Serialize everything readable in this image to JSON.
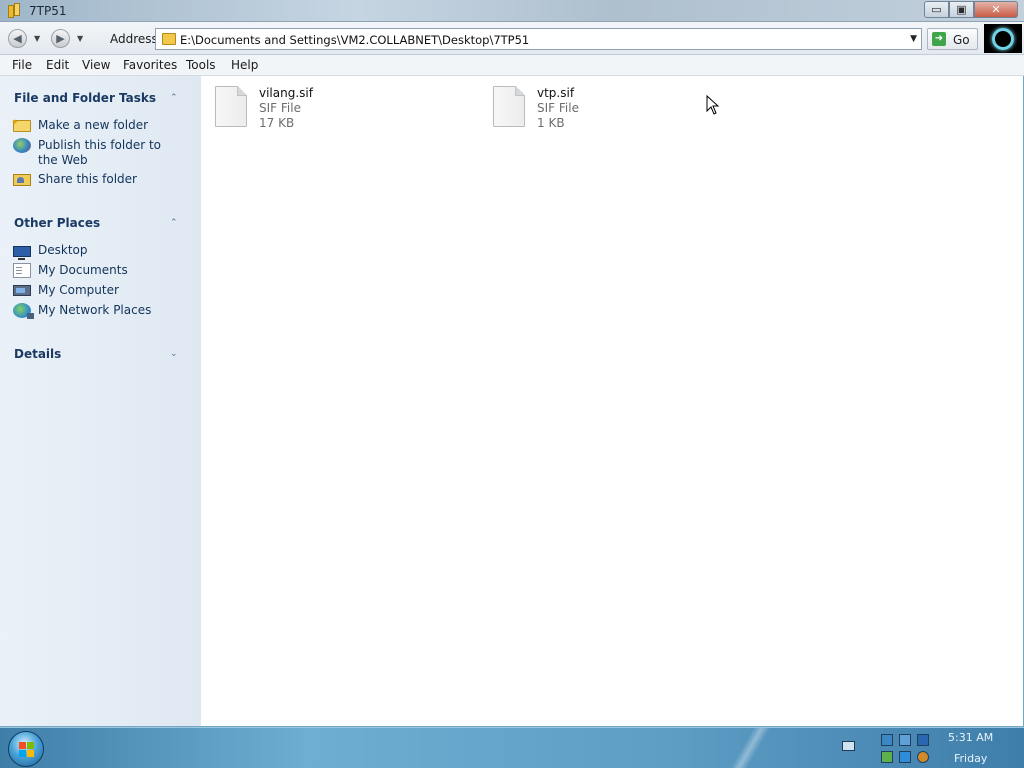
{
  "window": {
    "title": "7TP51",
    "controls": {
      "minimize": "▭",
      "maximize": "▣",
      "close": "✕"
    }
  },
  "address_bar": {
    "back_icon": "back-arrow-icon",
    "forward_icon": "forward-arrow-icon",
    "label": "Address",
    "path": "E:\\Documents and Settings\\VM2.COLLABNET\\Desktop\\7TP51",
    "go_label": "Go"
  },
  "menu": {
    "items": [
      "File",
      "Edit",
      "View",
      "Favorites",
      "Tools",
      "Help"
    ]
  },
  "task_pane": {
    "sections": [
      {
        "title": "File and Folder Tasks",
        "toggle": "⌃",
        "items": [
          {
            "label": "Make a new folder",
            "icon": "new-folder-icon"
          },
          {
            "label": "Publish this folder to the Web",
            "icon": "globe-icon"
          },
          {
            "label": "Share this folder",
            "icon": "share-folder-icon"
          }
        ]
      },
      {
        "title": "Other Places",
        "toggle": "⌃",
        "items": [
          {
            "label": "Desktop",
            "icon": "desktop-icon"
          },
          {
            "label": "My Documents",
            "icon": "documents-icon"
          },
          {
            "label": "My Computer",
            "icon": "computer-icon"
          },
          {
            "label": "My Network Places",
            "icon": "network-icon"
          }
        ]
      },
      {
        "title": "Details",
        "toggle": "⌄",
        "items": []
      }
    ]
  },
  "files": [
    {
      "name": "vilang.sif",
      "type": "SIF File",
      "size": "17 KB"
    },
    {
      "name": "vtp.sif",
      "type": "SIF File",
      "size": "1 KB"
    }
  ],
  "taskbar": {
    "time": "5:31 AM",
    "day": "Friday"
  },
  "colors": {
    "task_pane_text": "#13345a",
    "task_pane_header": "#1b3a63",
    "taskbar": "#5e9dc4"
  }
}
